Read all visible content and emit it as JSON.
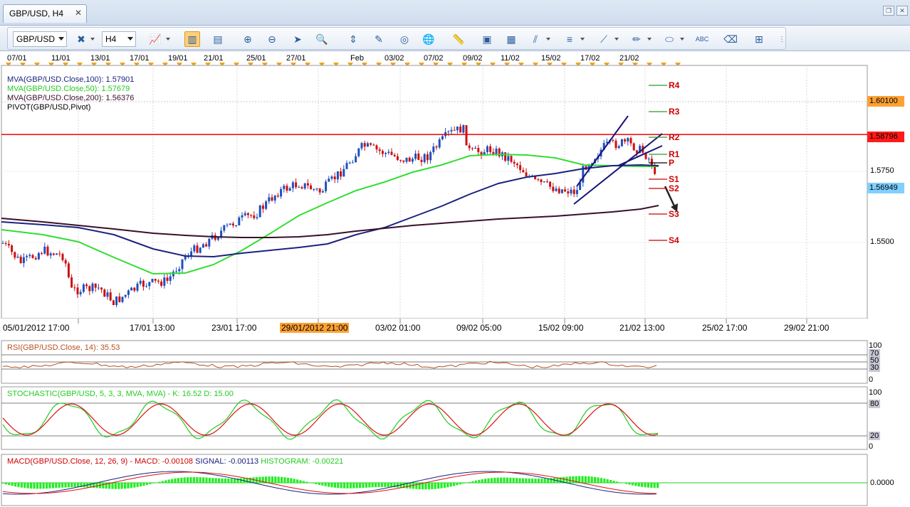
{
  "window": {
    "tab_title": "GBP/USD, H4",
    "close_symbol": "✕"
  },
  "toolbar": {
    "symbol": "GBP/USD",
    "timeframe": "H4",
    "icons": [
      "bar-chart-icon",
      "crosshair-icon",
      "candlestick-icon",
      "line-chart-icon",
      "zoom-in-icon",
      "zoom-out-icon",
      "cursor-icon",
      "zoom-select-icon",
      "vertical-line-icon",
      "edit-icon",
      "cycle-icon",
      "globe-icon",
      "ruler-icon",
      "image-icon",
      "template-icon",
      "drawing-tools-icon",
      "fibonacci-icon",
      "trendline-icon",
      "pencil-icon",
      "ellipse-icon",
      "text-icon",
      "eraser-icon",
      "hierarchy-icon"
    ]
  },
  "date_header": [
    "07/01",
    "11/01",
    "13/01",
    "17/01",
    "19/01",
    "21/01",
    "25/01",
    "27/01",
    "Feb",
    "03/02",
    "07/02",
    "09/02",
    "11/02",
    "15/02",
    "17/02",
    "21/02"
  ],
  "x_axis": {
    "labels": [
      "05/01/2012 17:00",
      "17/01 13:00",
      "23/01 17:00",
      "29/01/2012 21:00",
      "03/02 01:00",
      "09/02 05:00",
      "15/02 09:00",
      "21/02 13:00",
      "25/02 17:00",
      "29/02 21:00"
    ],
    "highlighted": "29/01/2012 21:00"
  },
  "price_panel": {
    "legend": [
      {
        "text": "MVA(GBP/USD.Close,100): 1.57901",
        "color": "#1a237e"
      },
      {
        "text": "MVA(GBP/USD.Close,50): 1.57679",
        "color": "#22cc22"
      },
      {
        "text": "MVA(GBP/USD.Close,200): 1.56376",
        "color": "#3a0f2a"
      },
      {
        "text": "PIVOT(GBP/USD,Pivot)",
        "color": "#000000"
      }
    ],
    "axis_labels": [
      "1.5750",
      "1.5500"
    ],
    "price_tags": [
      {
        "text": "1.60100",
        "bg": "#ffa033"
      },
      {
        "text": "1.58796",
        "bg": "#ff1a1a"
      },
      {
        "text": "1.56949",
        "bg": "#7fd0ff"
      }
    ],
    "pivot_levels": [
      "R4",
      "R3",
      "R2",
      "R1",
      "P",
      "S1",
      "S2",
      "S3",
      "S4"
    ],
    "resistance_line": 1.58796
  },
  "rsi_panel": {
    "legend": "RSI(GBP/USD.Close, 14): 35.53",
    "axis_labels": [
      "100",
      "70",
      "50",
      "30",
      "0"
    ],
    "value": 35.53
  },
  "stoch_panel": {
    "legend": "STOCHASTIC(GBP/USD, 5, 3, 3, MVA, MVA) - K: 16.52  D: 15.00",
    "axis_labels": [
      "100",
      "80",
      "20",
      "0"
    ],
    "k": 16.52,
    "d": 15.0
  },
  "macd_panel": {
    "legend_prefix": "MACD(GBP/USD.Close, 12, 26, 9) - ",
    "macd": "MACD: -0.00108",
    "signal": "SIGNAL: -0.00113",
    "histogram": "HISTOGRAM: -0.00221",
    "axis_labels": [
      "0.0000"
    ]
  },
  "colors": {
    "up_candle": "#1f4fbf",
    "down_candle": "#cc1111",
    "ma50": "#33dd33",
    "ma100": "#1a237e",
    "ma200": "#3a0f2a",
    "resistance": "#ee0000",
    "rsi_line": "#b85020",
    "stoch_k": "#22cc22",
    "stoch_d": "#dd1111",
    "macd_line": "#1a237e",
    "signal_line": "#dd1111",
    "histogram": "#22ee22"
  }
}
